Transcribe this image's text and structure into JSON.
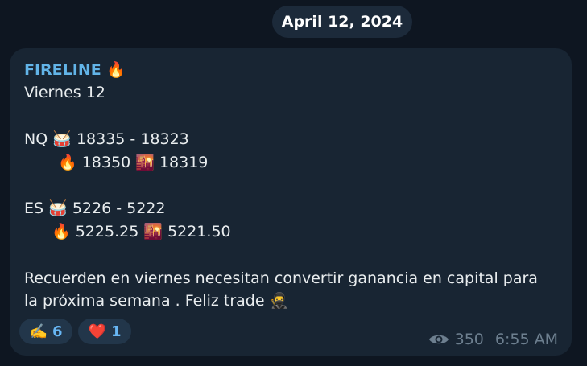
{
  "date_label": "April 12, 2024",
  "message": {
    "sender": "FIRELINE",
    "sender_emoji": "🔥",
    "lines": {
      "day": "Viernes 12",
      "nq_label": "NQ",
      "nq_drum": "🥁",
      "nq_range": "18335 - 18323",
      "nq_fire": "🔥",
      "nq_up": "18350",
      "nq_sunset": "🌇",
      "nq_down": "18319",
      "es_label": "ES",
      "es_drum": "🥁",
      "es_range": "5226 - 5222",
      "es_fire": "🔥",
      "es_up": "5225.25",
      "es_sunset": "🌇",
      "es_down": "5221.50",
      "note_line1": "Recuerden en viernes necesitan convertir ganancia en capital para",
      "note_line2": "la próxima semana . Feliz trade",
      "note_emoji": "🥷"
    }
  },
  "reactions": [
    {
      "emoji": "✍️",
      "count": "6"
    },
    {
      "emoji": "❤️",
      "count": "1"
    }
  ],
  "views": "350",
  "time": "6:55 AM",
  "icons": {
    "views_icon": "eye-icon"
  },
  "colors": {
    "background": "#0e1621",
    "bubble": "#182533",
    "sender": "#62b4e8",
    "text": "#e9edef",
    "meta": "#6d7f8f",
    "reaction_bg": "#22364a",
    "reaction_count": "#68b7f5"
  }
}
